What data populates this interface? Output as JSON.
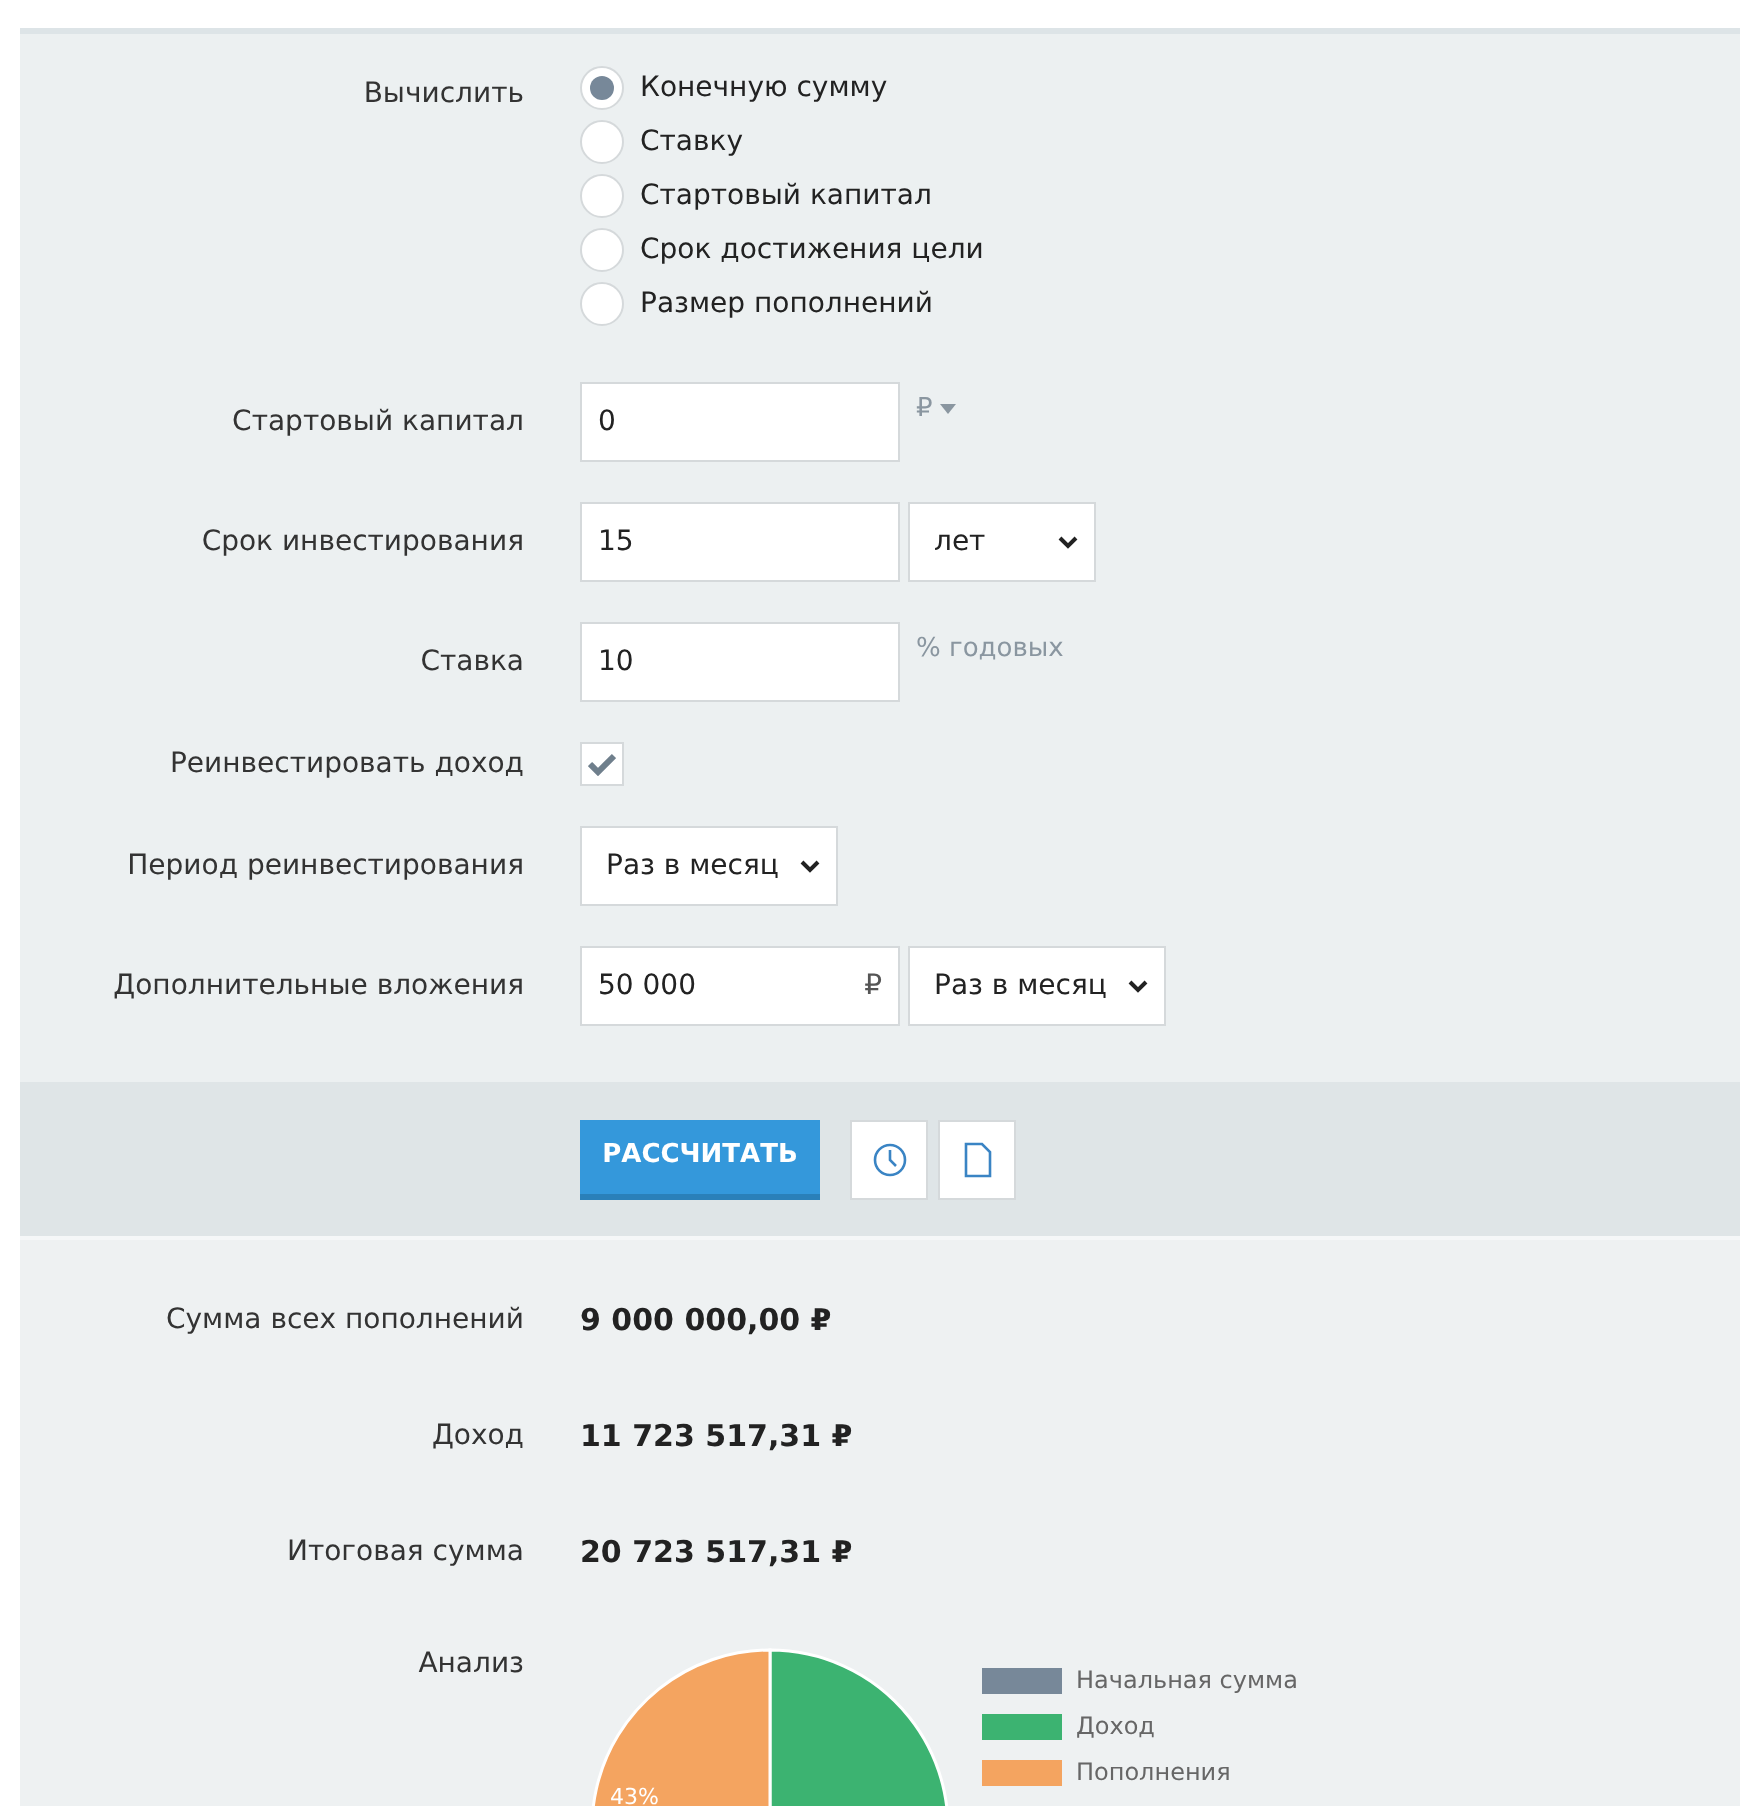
{
  "calculate": {
    "label": "Вычислить",
    "options": [
      {
        "label": "Конечную сумму",
        "selected": true
      },
      {
        "label": "Ставку",
        "selected": false
      },
      {
        "label": "Стартовый капитал",
        "selected": false
      },
      {
        "label": "Срок достижения цели",
        "selected": false
      },
      {
        "label": "Размер пополнений",
        "selected": false
      }
    ]
  },
  "fields": [
    {
      "kind": "input",
      "label": "Стартовый капитал",
      "value": "0",
      "suffix": "₽",
      "suffix_dropdown": true
    },
    {
      "kind": "input_select",
      "label": "Срок инвестирования",
      "value": "15",
      "select": "лет"
    },
    {
      "kind": "input",
      "label": "Ставка",
      "value": "10",
      "suffix": "% годовых"
    },
    {
      "kind": "checkbox",
      "label": "Реинвестировать доход",
      "checked": true
    },
    {
      "kind": "select",
      "label": "Период реинвестирования",
      "select": "Раз в месяц"
    },
    {
      "kind": "input_select",
      "label": "Дополнительные вложения",
      "value": "50 000",
      "inner_suffix": "₽",
      "select": "Раз в месяц"
    }
  ],
  "calculate_button": "РАССЧИТАТЬ",
  "results": [
    {
      "label": "Сумма всех пополнений",
      "value": "9 000 000,00 ₽"
    },
    {
      "label": "Доход",
      "value": "11 723 517,31 ₽"
    },
    {
      "label": "Итоговая сумма",
      "value": "20 723 517,31 ₽"
    }
  ],
  "analysis": {
    "label": "Анализ",
    "chart_data": {
      "type": "pie",
      "categories": [
        "Начальная сумма",
        "Доход",
        "Пополнения"
      ],
      "values": [
        0,
        57,
        43
      ],
      "colors": [
        "#778899",
        "#3cb371",
        "#f4a460"
      ],
      "value_labels": [
        null,
        null,
        "43%"
      ]
    }
  }
}
